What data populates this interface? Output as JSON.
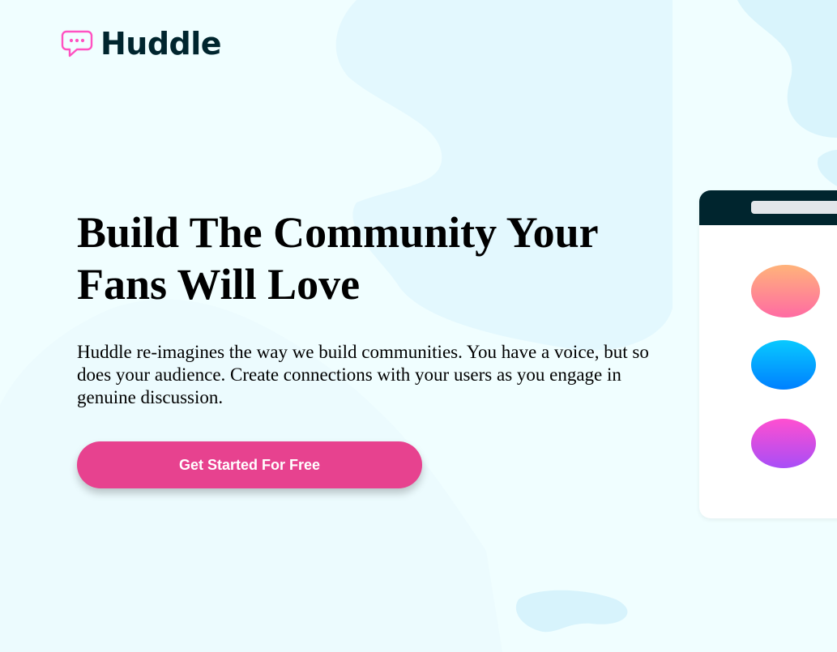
{
  "brand": {
    "name": "Huddle",
    "icon": "chat-bubble-icon",
    "icon_color": "#ff52c1",
    "text_color": "#00252e"
  },
  "hero": {
    "title": "Build The Community Your Fans Will Love",
    "description": "Huddle re-imagines the way we build communities. You have a voice, but so does your audience. Create connections with your users as you engage in genuine discussion.",
    "cta_label": "Get Started For Free"
  },
  "colors": {
    "background": "#f0feff",
    "cta": "#e7428f",
    "phone_header": "#00252e"
  },
  "mockup": {
    "avatars": [
      "orange-pink-avatar",
      "blue-avatar",
      "pink-purple-avatar"
    ]
  }
}
